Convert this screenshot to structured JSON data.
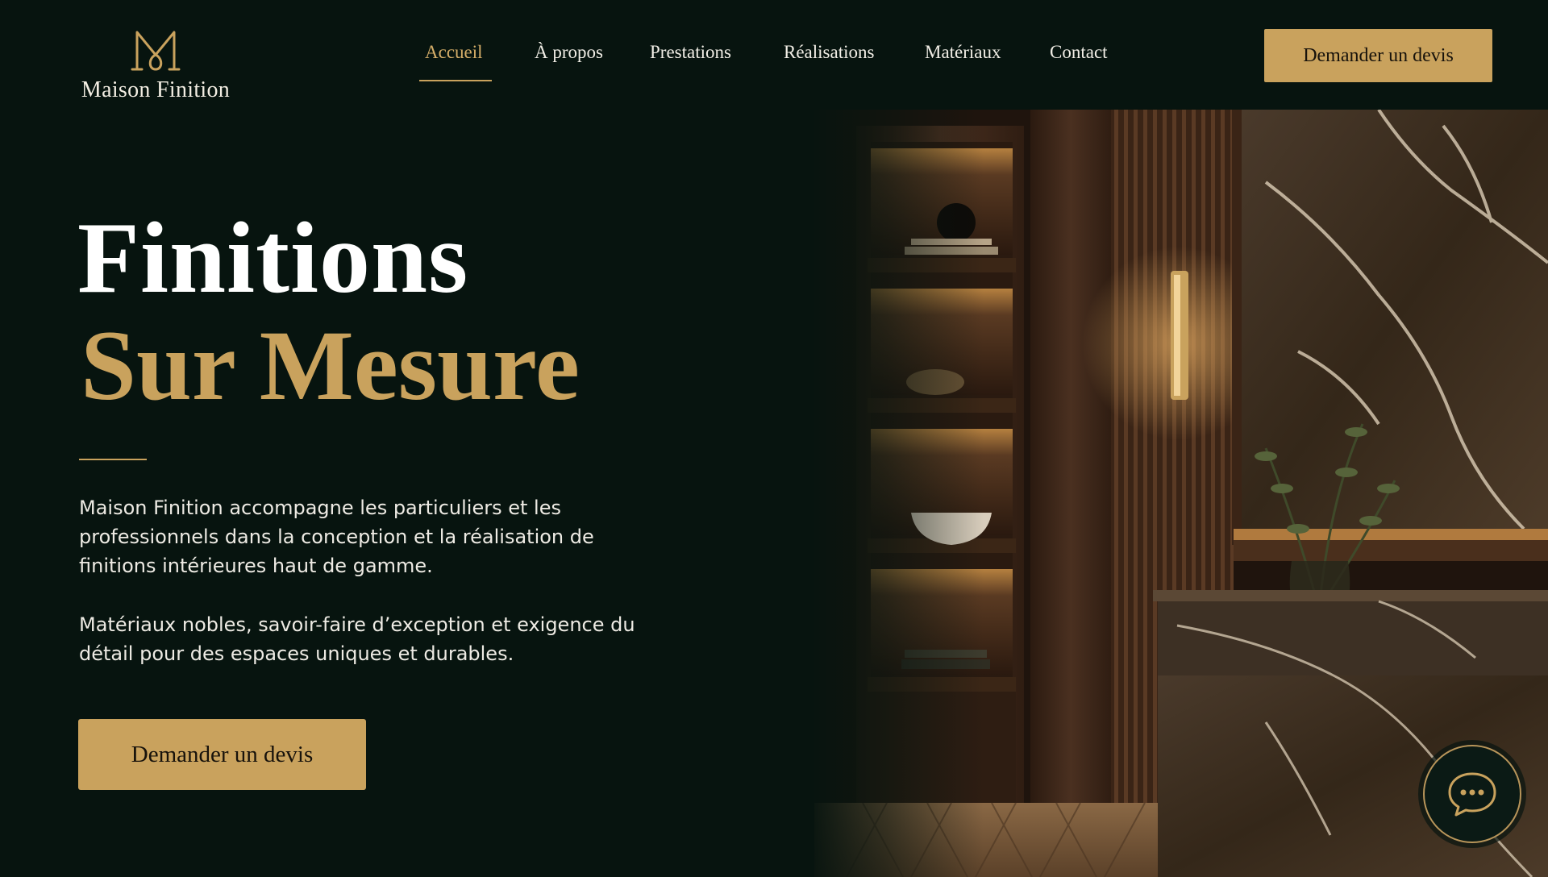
{
  "brand": {
    "name": "Maison Finition",
    "logo_icon": "monogram-mf-icon"
  },
  "nav": {
    "items": [
      {
        "label": "Accueil",
        "active": true
      },
      {
        "label": "À propos",
        "active": false
      },
      {
        "label": "Prestations",
        "active": false
      },
      {
        "label": "Réalisations",
        "active": false
      },
      {
        "label": "Matériaux",
        "active": false
      },
      {
        "label": "Contact",
        "active": false
      }
    ]
  },
  "header": {
    "cta_label": "Demander un devis"
  },
  "hero": {
    "title_line1": "Finitions",
    "title_line2": "Sur Mesure",
    "paragraph1": "Maison Finition accompagne les particuliers et les professionnels dans la conception et la réalisation de finitions intérieures haut de gamme.",
    "paragraph2": "Matériaux nobles, savoir-faire d’exception et exigence du détail pour des espaces uniques et durables.",
    "cta_label": "Demander un devis"
  },
  "chat": {
    "icon": "chat-bubble-icon"
  },
  "colors": {
    "background": "#07140f",
    "accent_gold": "#c9a25d",
    "text_light": "#f1eee6",
    "wood": "#4a3020",
    "marble": "#3b2e22"
  }
}
